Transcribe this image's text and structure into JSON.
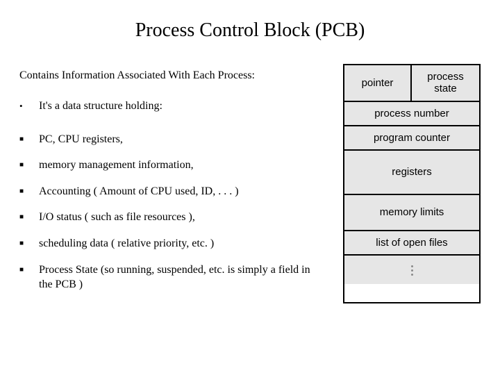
{
  "title": "Process Control Block (PCB)",
  "subtitle": "Contains Information Associated With Each Process:",
  "first_item": "It's a data structure holding:",
  "items": [
    "PC, CPU registers,",
    "memory management information,",
    "Accounting ( Amount of CPU used, ID, . . . )",
    "I/O status ( such as file resources ),",
    "scheduling data ( relative priority, etc. )",
    "Process State (so running, suspended, etc. is simply a field in the PCB )"
  ],
  "diagram": {
    "pointer": "pointer",
    "process_state": "process state",
    "process_number": "process number",
    "program_counter": "program counter",
    "registers": "registers",
    "memory_limits": "memory limits",
    "open_files": "list of open files"
  }
}
